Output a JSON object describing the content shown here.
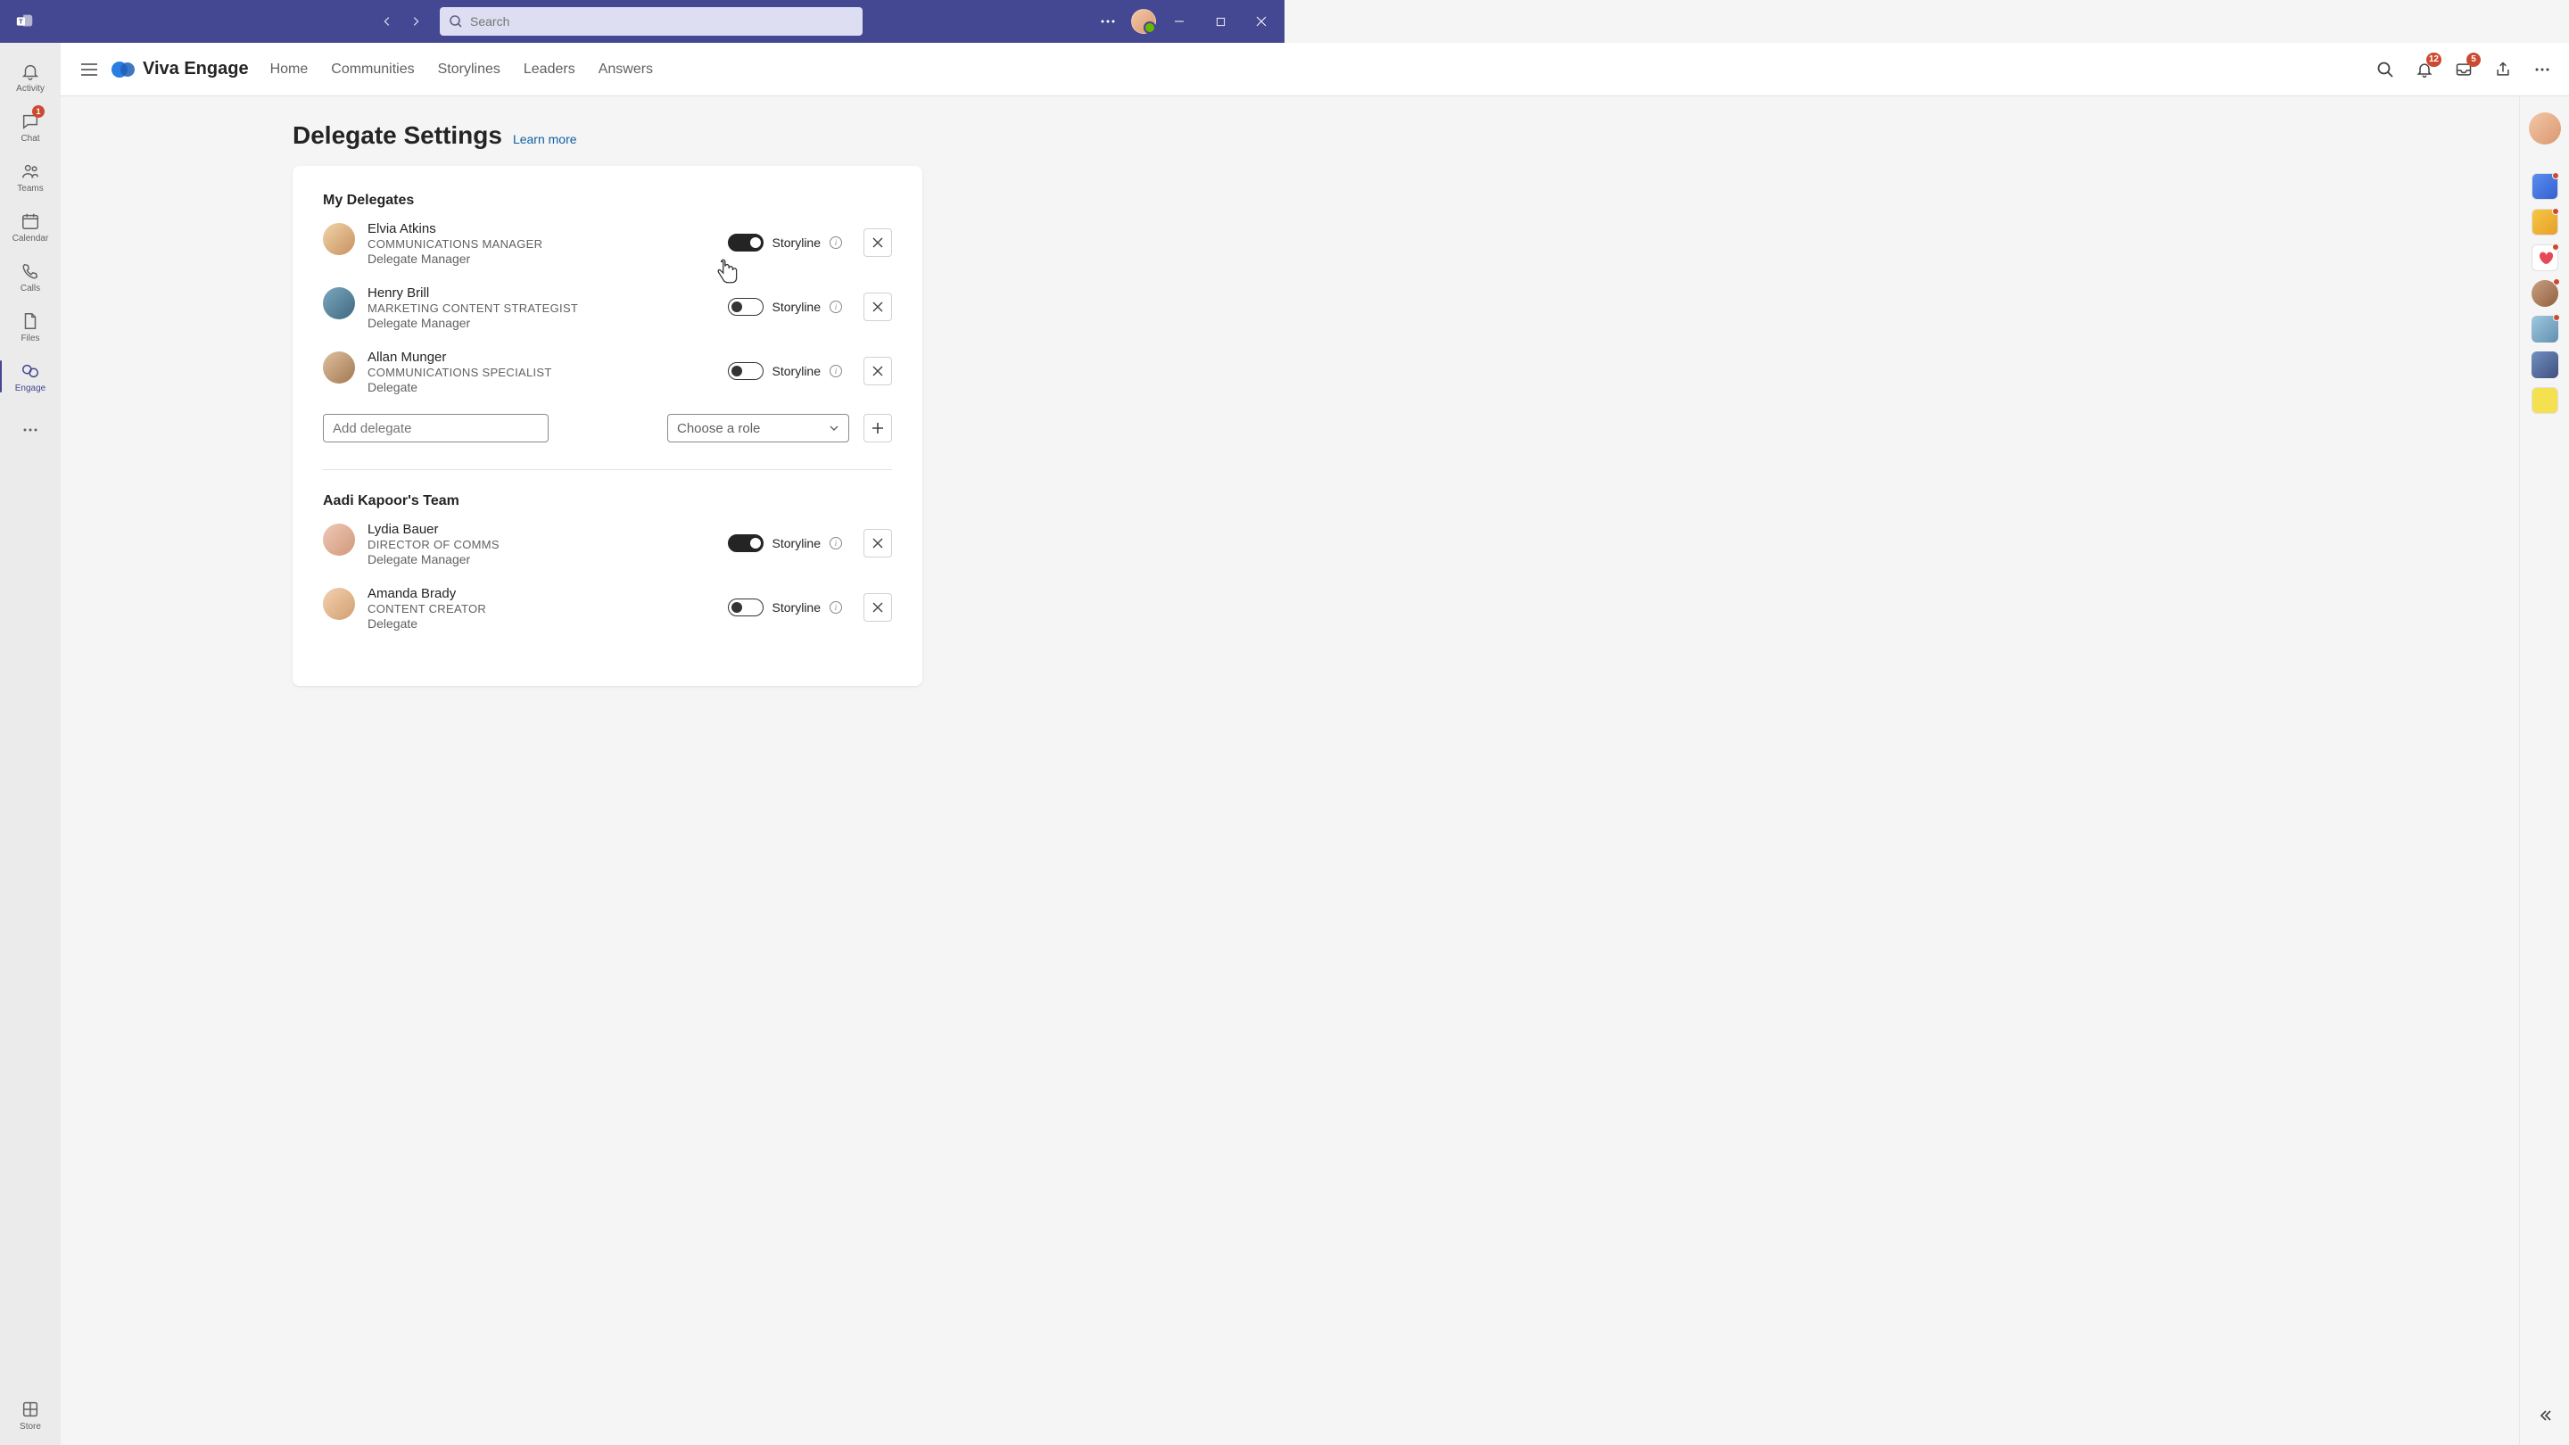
{
  "titlebar": {
    "search_placeholder": "Search"
  },
  "apprail": {
    "activity": "Activity",
    "chat": "Chat",
    "chat_badge": "1",
    "teams": "Teams",
    "calendar": "Calendar",
    "calls": "Calls",
    "files": "Files",
    "engage": "Engage",
    "store": "Store"
  },
  "veheader": {
    "title": "Viva Engage",
    "nav": {
      "home": "Home",
      "communities": "Communities",
      "storylines": "Storylines",
      "leaders": "Leaders",
      "answers": "Answers"
    },
    "notif_badge": "12",
    "inbox_badge": "5"
  },
  "page": {
    "title": "Delegate Settings",
    "learn_more": "Learn more"
  },
  "sections": {
    "my_delegates_title": "My Delegates",
    "team_title": "Aadi Kapoor's Team"
  },
  "labels": {
    "storyline": "Storyline",
    "add_delegate_placeholder": "Add delegate",
    "choose_role": "Choose a role"
  },
  "delegates": {
    "d0": {
      "name": "Elvia Atkins",
      "job": "COMMUNICATIONS MANAGER",
      "role": "Delegate Manager"
    },
    "d1": {
      "name": "Henry Brill",
      "job": "MARKETING CONTENT STRATEGIST",
      "role": "Delegate Manager"
    },
    "d2": {
      "name": "Allan Munger",
      "job": "COMMUNICATIONS SPECIALIST",
      "role": "Delegate"
    },
    "d3": {
      "name": "Lydia Bauer",
      "job": "DIRECTOR OF COMMS",
      "role": "Delegate Manager"
    },
    "d4": {
      "name": "Amanda Brady",
      "job": "CONTENT CREATOR",
      "role": "Delegate"
    }
  }
}
